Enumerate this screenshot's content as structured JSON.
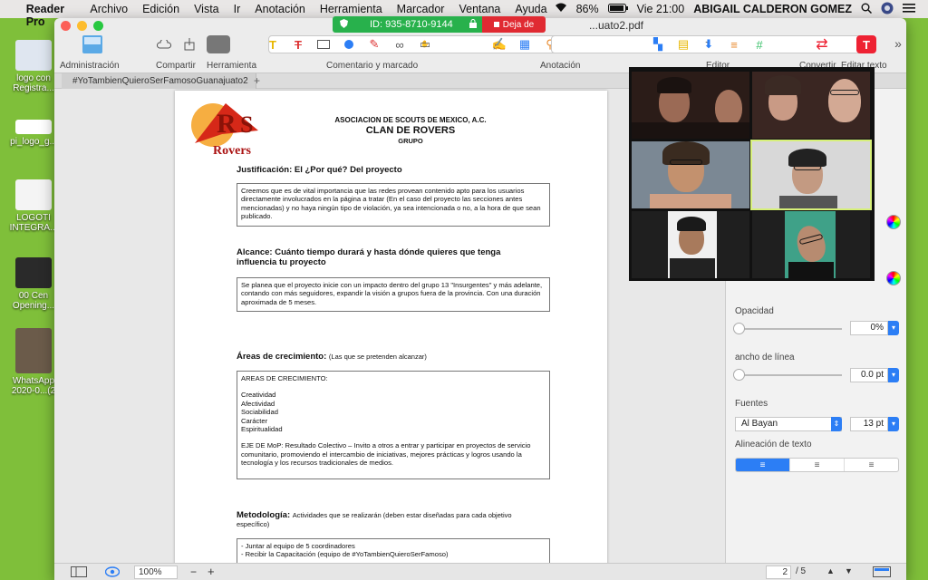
{
  "menubar": {
    "app": "PDF Reader Pro",
    "items": [
      "Archivo",
      "Edición",
      "Vista",
      "Ir",
      "Anotación",
      "Herramienta",
      "Marcador",
      "Ventana",
      "Ayuda"
    ],
    "battery": "86%",
    "clock": "Vie 21:00",
    "user": "ABIGAIL CALDERON GOMEZ"
  },
  "desktop": [
    {
      "label": "logo con Registra...",
      "color": "#dfe6f0"
    },
    {
      "label": "pi_logo_g...",
      "color": "#ffffff"
    },
    {
      "label": "LOGOTI INTEGRA...",
      "color": "#f4f4f4"
    },
    {
      "label": "00 Cen Opening...",
      "color": "#2a2a2a"
    },
    {
      "label": "WhatsApp 2020-0...(2",
      "color": "#6b5b4a"
    }
  ],
  "window": {
    "title": "...uato2.pdf"
  },
  "zoom": {
    "meeting_id": "ID: 935-8710-9144",
    "leave": "Deja de"
  },
  "toolbar": {
    "groups": {
      "admin": "Administración",
      "share": "Compartir",
      "tool": "Herramienta",
      "comment": "Comentario y marcado",
      "annotation": "Anotación",
      "editor": "Editor",
      "convert": "Convertir",
      "edit_text": "Editar texto"
    }
  },
  "tab": {
    "label": "#YoTambienQuieroSerFamosoGuanajuato2",
    "add": "+"
  },
  "document": {
    "org": "ASOCIACION DE SCOUTS DE MEXICO, A.C.",
    "clan": "CLAN DE ROVERS",
    "grupo": "GRUPO",
    "logo_text": "Rovers",
    "s1_title": "Justificación: El ¿Por qué? Del proyecto",
    "s1_body": "Creemos que es de vital importancia que las redes provean contenido apto para los usuarios directamente involucrados en la página a tratar (En el caso del proyecto las secciones antes mencionadas) y no haya ningún tipo de violación, ya sea intencionada o no, a la hora de que sean publicado.",
    "s2_title": "Alcance: Cuánto tiempo durará y hasta dónde quieres que tenga influencia tu proyecto",
    "s2_body": "Se planea que el proyecto inicie con un impacto dentro del grupo 13 \"Insurgentes\" y más adelante, contando con más seguidores, expandir la visión a grupos fuera de la provincia. Con una duración aproximada de 5 meses.",
    "s3_title": "Áreas de crecimiento:",
    "s3_sub": "(Las que se pretenden alcanzar)",
    "s3_head": "AREAS DE CRECIMIENTO:",
    "s3_list": [
      "Creatividad",
      "Afectividad",
      "Sociabilidad",
      "Carácter",
      "Espiritualidad"
    ],
    "s3_eje": "EJE DE MoP: Resultado Colectivo – Invito a otros a entrar y participar en proyectos de servicio comunitario, promoviendo el intercambio de iniciativas, mejores prácticas y logros usando la tecnología y los recursos tradicionales de medios.",
    "s4_title": "Metodología:",
    "s4_sub": "Actividades que se realizarán (deben estar diseñadas para cada objetivo específico)",
    "s4_items": [
      "- Juntar al equipo de 5 coordinadores",
      "- Recibir la Capacitación (equipo de #YoTambienQuieroSerFamoso)"
    ]
  },
  "panel": {
    "opacity_label": "Opacidad",
    "opacity_value": "0%",
    "line_label": "ancho de línea",
    "line_value": "0.0 pt",
    "fonts_label": "Fuentes",
    "font_name": "Al Bayan",
    "font_size": "13 pt",
    "align_label": "Alineación de texto"
  },
  "status": {
    "zoom": "100%",
    "zoom_out": "−",
    "zoom_in": "+",
    "page": "2",
    "total": "/ 5"
  }
}
